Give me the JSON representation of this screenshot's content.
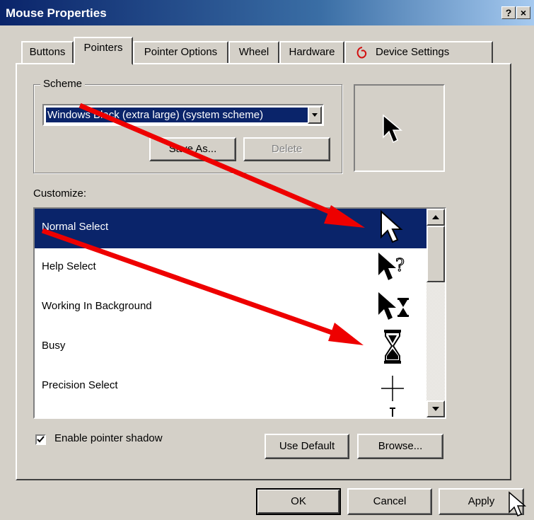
{
  "window": {
    "title": "Mouse Properties",
    "help_btn": "?",
    "close_btn": "×"
  },
  "tabs": [
    {
      "label": "Buttons"
    },
    {
      "label": "Pointers"
    },
    {
      "label": "Pointer Options"
    },
    {
      "label": "Wheel"
    },
    {
      "label": "Hardware"
    },
    {
      "label": "Device Settings"
    }
  ],
  "scheme": {
    "group_label": "Scheme",
    "selected": "Windows Black (extra large) (system scheme)",
    "save_as": "Save As...",
    "delete": "Delete"
  },
  "customize": {
    "label": "Customize:",
    "items": [
      {
        "label": "Normal Select",
        "icon": "arrow-cursor-icon"
      },
      {
        "label": "Help Select",
        "icon": "help-cursor-icon"
      },
      {
        "label": "Working In Background",
        "icon": "working-cursor-icon"
      },
      {
        "label": "Busy",
        "icon": "hourglass-cursor-icon"
      },
      {
        "label": "Precision Select",
        "icon": "crosshair-cursor-icon"
      }
    ]
  },
  "options": {
    "shadow_label": "Enable pointer shadow",
    "shadow_checked": true,
    "use_default": "Use Default",
    "browse": "Browse..."
  },
  "footer": {
    "ok": "OK",
    "cancel": "Cancel",
    "apply": "Apply"
  },
  "colors": {
    "selection": "#0a246a",
    "annotation_arrow": "#ee0000",
    "face": "#d4d0c8"
  }
}
